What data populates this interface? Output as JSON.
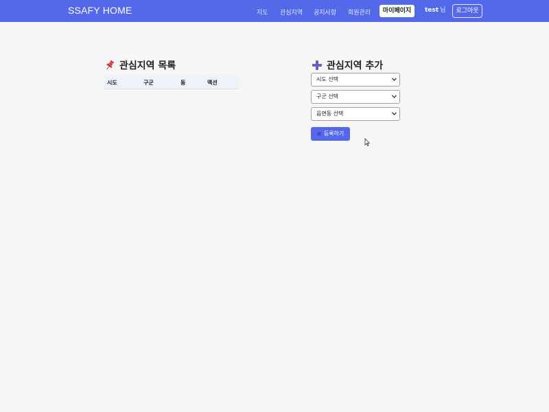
{
  "navbar": {
    "brand": "SSAFY HOME",
    "links": [
      "지도",
      "관심지역",
      "공지사항",
      "회원관리"
    ],
    "active_link": "마이페이지",
    "user_name": "test",
    "user_suffix": "님",
    "logout_label": "로그아웃",
    "accent_color": "#5468ea"
  },
  "list_section": {
    "title": "관심지역 목록",
    "icon": "pushpin-icon",
    "columns": [
      "시도",
      "구군",
      "동",
      "액션"
    ]
  },
  "add_section": {
    "title": "관심지역 추가",
    "icon": "plus-icon",
    "selects": [
      {
        "value": "시도 선택"
      },
      {
        "value": "구군 선택"
      },
      {
        "value": "읍면동 선택"
      }
    ],
    "submit_label": "등록하기"
  }
}
